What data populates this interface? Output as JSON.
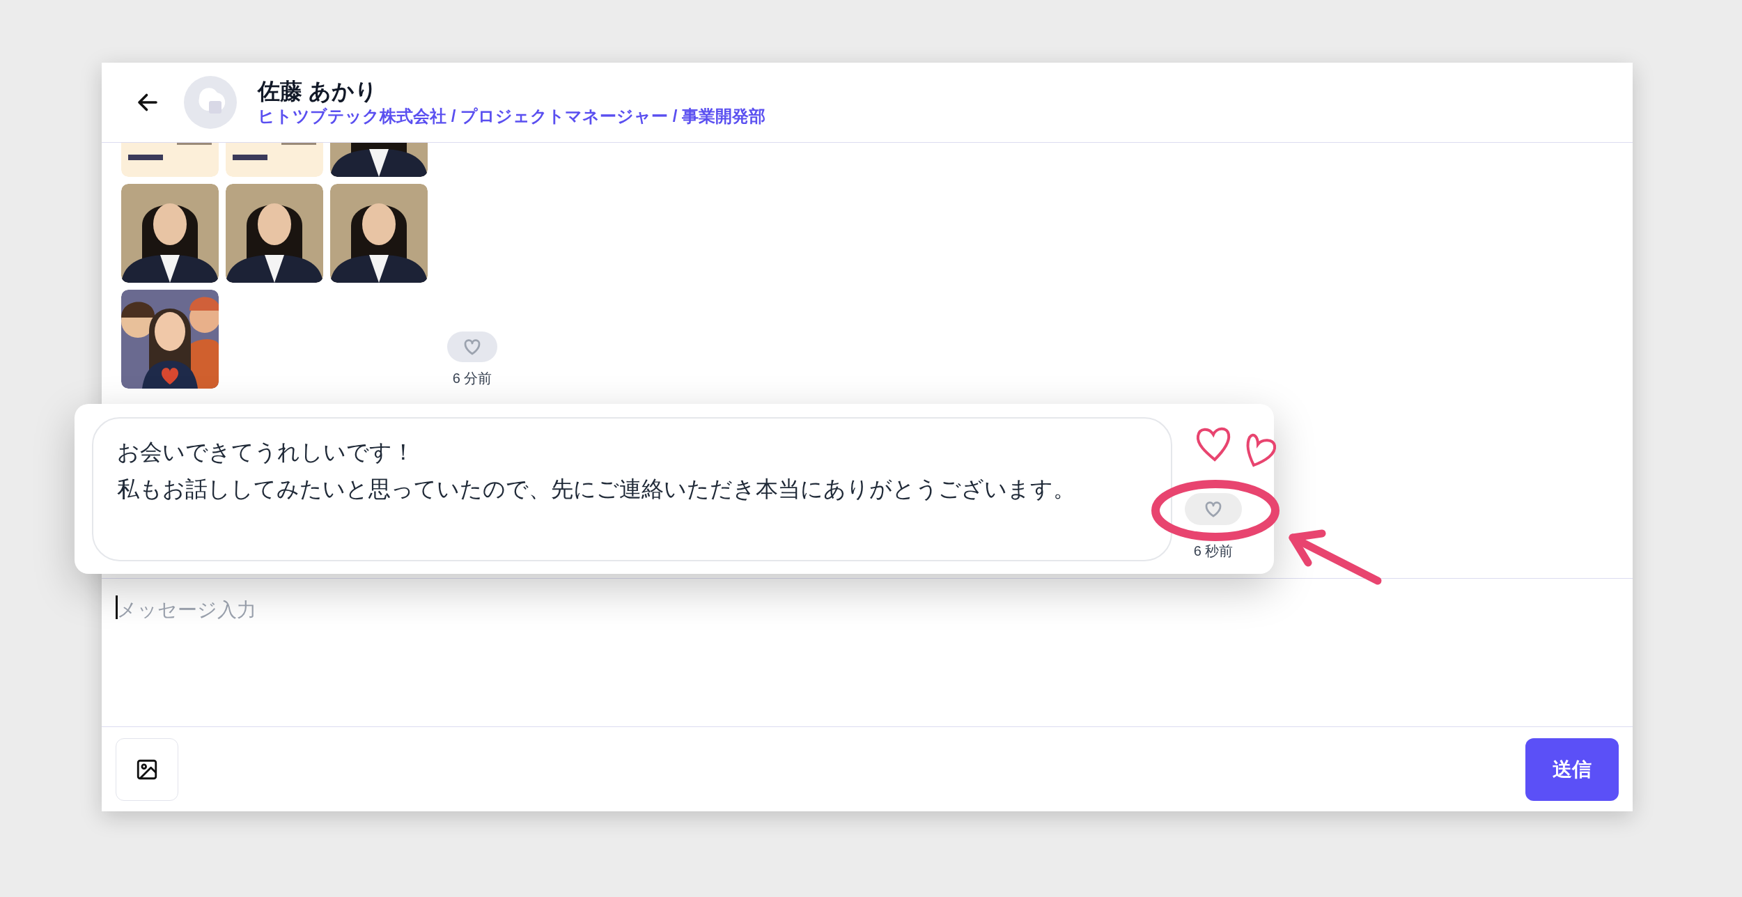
{
  "header": {
    "name": "佐藤 あかり",
    "subtitle": "ヒトツブテック株式会社 / プロジェクトマネージャー / 事業開発部"
  },
  "messages": [
    {
      "kind": "images",
      "liked": false,
      "time": "6 分前",
      "focused": false
    },
    {
      "kind": "text",
      "lines": [
        "お会いできてうれしいです！",
        "私もお話ししてみたいと思っていたので、先にご連絡いただき本当にありがとうございます。"
      ],
      "liked": false,
      "time": "6 秒前",
      "focused": true
    }
  ],
  "composer": {
    "placeholder": "メッセージ入力",
    "send": "送信"
  }
}
